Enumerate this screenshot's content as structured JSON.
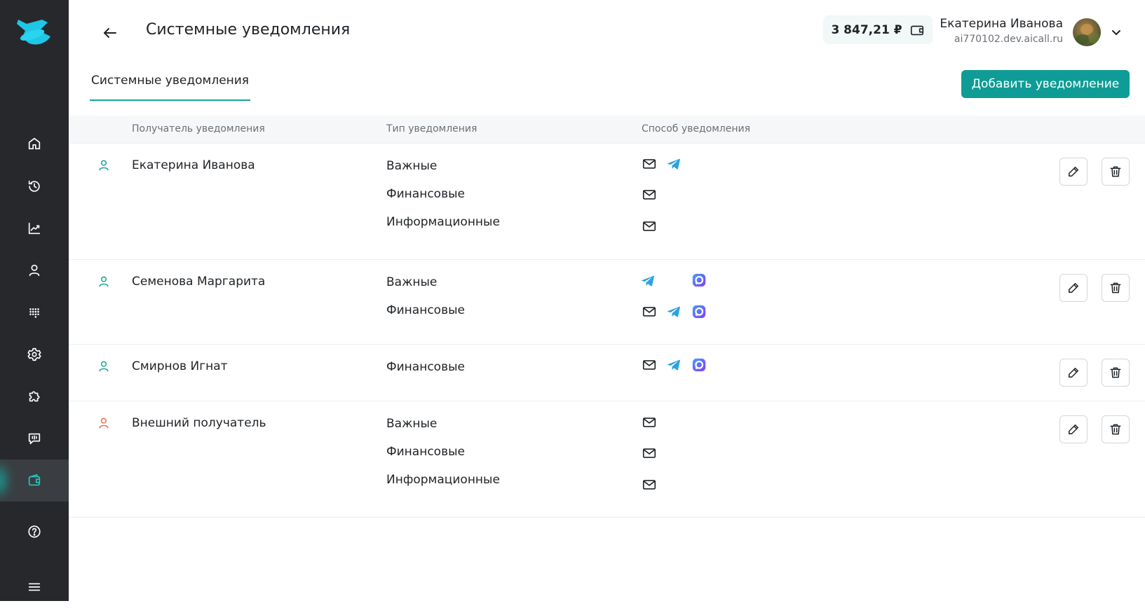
{
  "header": {
    "title": "Системные уведомления",
    "balance": "3 847,21 ₽",
    "user_name": "Екатерина Иванова",
    "user_domain": "ai770102.dev.aicall.ru"
  },
  "tabs": [
    {
      "label": "Системные уведомления",
      "active": true
    }
  ],
  "actions": {
    "add_label": "Добавить уведомление"
  },
  "table": {
    "columns": [
      "Получатель уведомления",
      "Тип уведомления",
      "Способ уведомления"
    ],
    "rows": [
      {
        "recipient": "Екатерина Иванова",
        "recipient_icon": "user-icon",
        "icon_color": "#13a39d",
        "types": [
          {
            "label": "Важные",
            "methods": [
              "mail-icon",
              "telegram-icon"
            ]
          },
          {
            "label": "Финансовые",
            "methods": [
              "mail-icon"
            ]
          },
          {
            "label": "Информационные",
            "methods": [
              "mail-icon"
            ]
          }
        ]
      },
      {
        "recipient": "Семенова Маргарита",
        "recipient_icon": "user-icon",
        "icon_color": "#13a39d",
        "types": [
          {
            "label": "Важные",
            "methods": [
              "telegram-icon",
              "max-icon"
            ]
          },
          {
            "label": "Финансовые",
            "methods": [
              "mail-icon",
              "telegram-icon",
              "max-icon"
            ]
          }
        ]
      },
      {
        "recipient": "Смирнов Игнат",
        "recipient_icon": "user-icon",
        "icon_color": "#13a39d",
        "types": [
          {
            "label": "Финансовые",
            "methods": [
              "mail-icon",
              "telegram-icon",
              "max-icon"
            ]
          }
        ]
      },
      {
        "recipient": "Внешний получатель",
        "recipient_icon": "user-icon",
        "icon_color": "#e8704f",
        "types": [
          {
            "label": "Важные",
            "methods": [
              "mail-icon"
            ]
          },
          {
            "label": "Финансовые",
            "methods": [
              "mail-icon"
            ]
          },
          {
            "label": "Информационные",
            "methods": [
              "mail-icon"
            ]
          }
        ]
      }
    ]
  },
  "sidebar": {
    "items": [
      {
        "icon": "home-icon"
      },
      {
        "icon": "history-icon"
      },
      {
        "icon": "analytics-icon"
      },
      {
        "icon": "user-icon"
      },
      {
        "icon": "dialpad-icon"
      },
      {
        "icon": "gear-icon"
      },
      {
        "icon": "puzzle-icon"
      },
      {
        "icon": "chat-icon"
      },
      {
        "icon": "wallet-icon",
        "active": true
      },
      {
        "icon": "help-icon"
      },
      {
        "icon": "menu-icon"
      }
    ]
  },
  "colors": {
    "accent": "#0f9c96",
    "sidebar_bg": "#26282b",
    "telegram": "#2aa3e0",
    "max_app": "#4b5bf0",
    "external_user": "#e8704f"
  }
}
